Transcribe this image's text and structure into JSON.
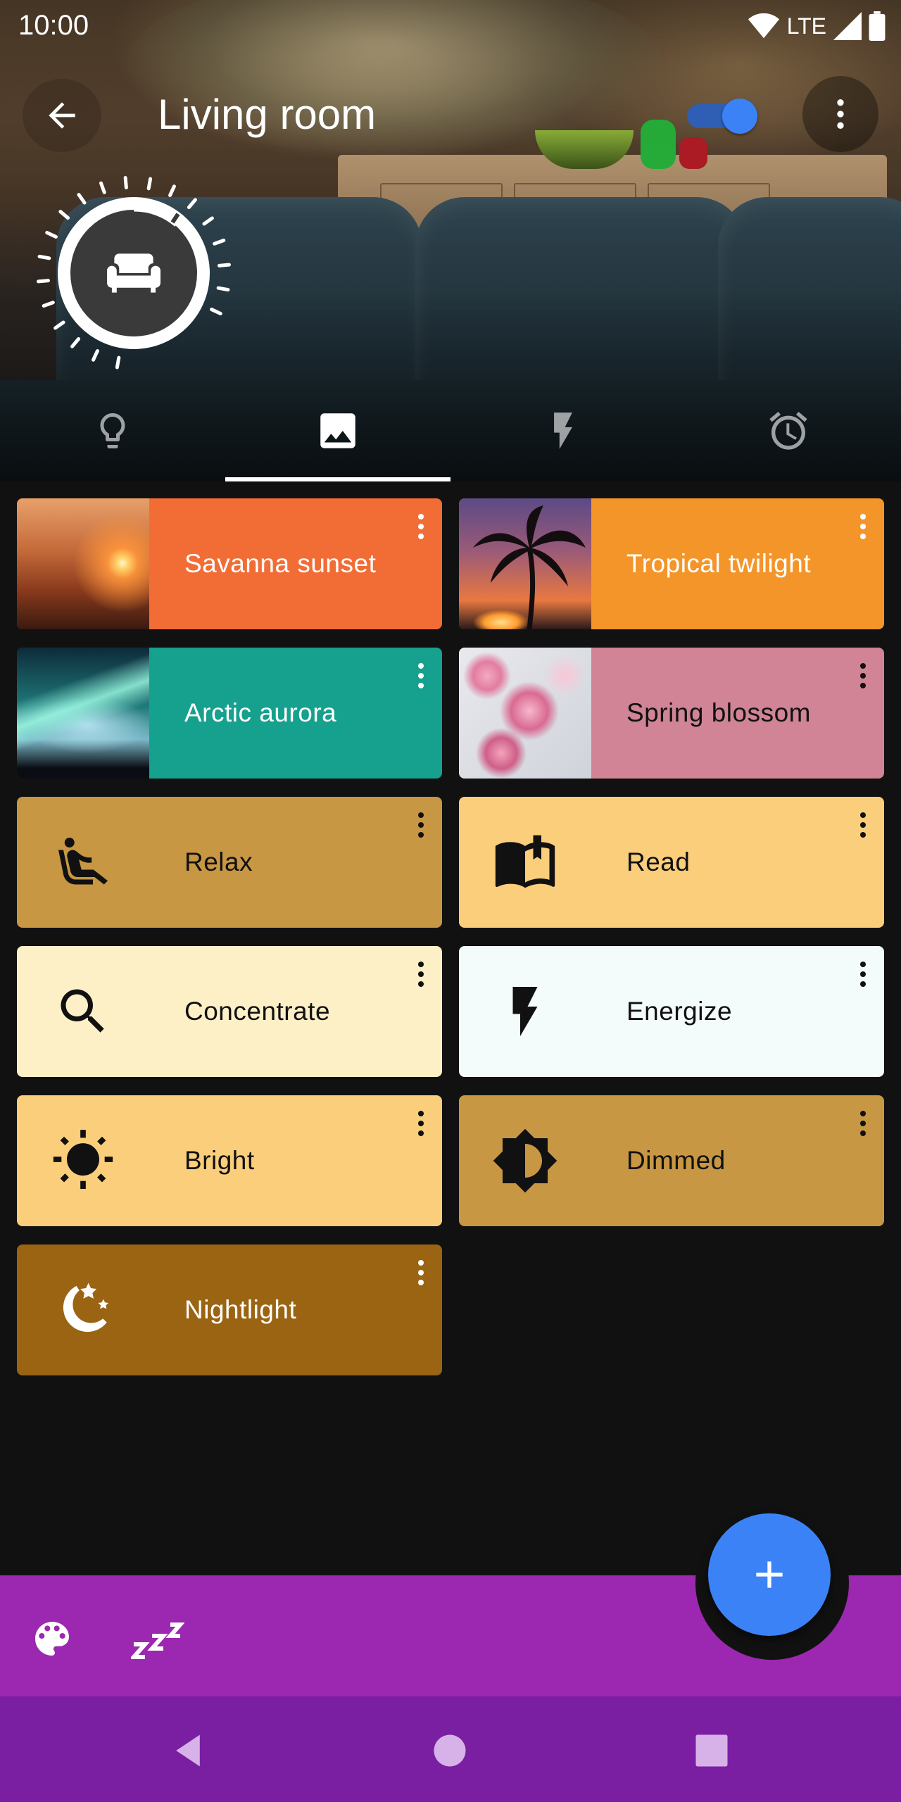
{
  "status_bar": {
    "time": "10:00",
    "network": "LTE"
  },
  "header": {
    "title": "Living room",
    "lights_on": true
  },
  "tabs": [
    {
      "name": "lights",
      "icon": "lightbulb-icon",
      "selected": false
    },
    {
      "name": "scenes",
      "icon": "image-icon",
      "selected": true
    },
    {
      "name": "effects",
      "icon": "flash-icon",
      "selected": false
    },
    {
      "name": "routines",
      "icon": "alarm-icon",
      "selected": false
    }
  ],
  "scenes": [
    {
      "label": "Savanna sunset",
      "color": "#f26d36",
      "type": "image",
      "icon": "savanna-thumbnail",
      "text_color": "#ffffff"
    },
    {
      "label": "Tropical twilight",
      "color": "#f4952a",
      "type": "image",
      "icon": "tropical-thumbnail",
      "text_color": "#ffffff"
    },
    {
      "label": "Arctic aurora",
      "color": "#16a08e",
      "type": "image",
      "icon": "aurora-thumbnail",
      "text_color": "#ffffff"
    },
    {
      "label": "Spring blossom",
      "color": "#d08496",
      "type": "image",
      "icon": "blossom-thumbnail",
      "text_color": "#111111"
    },
    {
      "label": "Relax",
      "color": "#c89743",
      "type": "icon",
      "icon": "seat-recline-icon",
      "text_color": "#111111"
    },
    {
      "label": "Read",
      "color": "#fbce7b",
      "type": "icon",
      "icon": "book-open-icon",
      "text_color": "#111111"
    },
    {
      "label": "Concentrate",
      "color": "#fdefc6",
      "type": "icon",
      "icon": "magnifier-icon",
      "text_color": "#111111"
    },
    {
      "label": "Energize",
      "color": "#f4fcfb",
      "type": "icon",
      "icon": "lightning-icon",
      "text_color": "#111111"
    },
    {
      "label": "Bright",
      "color": "#fbce7b",
      "type": "icon",
      "icon": "sun-icon",
      "text_color": "#111111"
    },
    {
      "label": "Dimmed",
      "color": "#c89743",
      "type": "icon",
      "icon": "brightness-half-icon",
      "text_color": "#111111"
    },
    {
      "label": "Nightlight",
      "color": "#9a6413",
      "type": "icon",
      "icon": "moon-stars-icon",
      "text_color": "#ffffff"
    }
  ],
  "bottom_bar": {
    "actions": [
      "palette-icon",
      "sleep-zzz-icon"
    ],
    "fab_icon": "plus-icon"
  },
  "colors": {
    "background": "#111111",
    "bottom_bar": "#9c27b0",
    "nav_bar": "#7b1fa2",
    "accent": "#3b82f6"
  }
}
